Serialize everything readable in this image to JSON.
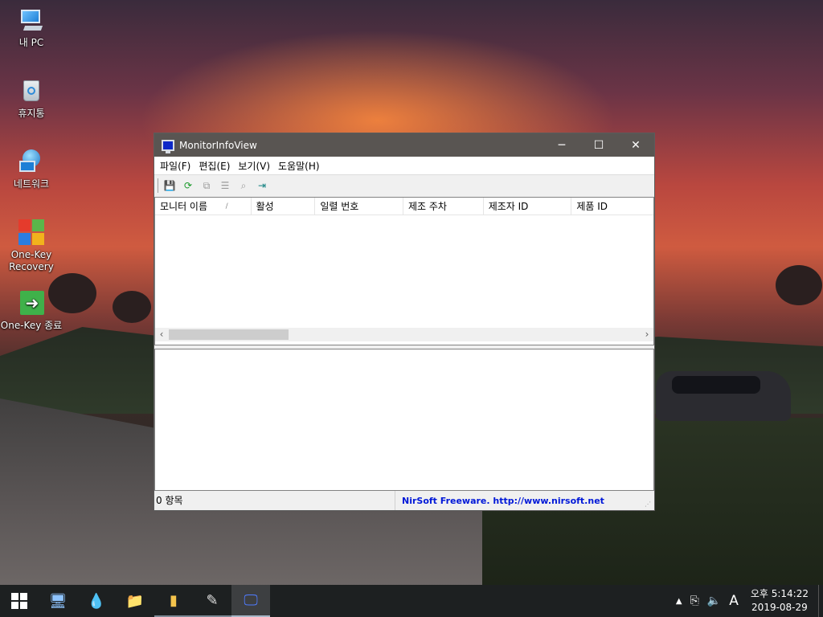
{
  "desktop": {
    "icons": [
      {
        "label": "내 PC",
        "icon": "computer-icon"
      },
      {
        "label": "휴지통",
        "icon": "recycle-bin-icon"
      },
      {
        "label": "네트워크",
        "icon": "network-icon"
      },
      {
        "label": "One-Key\nRecovery",
        "icon": "onekey-recovery-icon"
      },
      {
        "label": "One-Key 종료",
        "icon": "exit-icon"
      }
    ]
  },
  "window": {
    "title": "MonitorInfoView",
    "menu": [
      "파일(F)",
      "편집(E)",
      "보기(V)",
      "도움말(H)"
    ],
    "columns": [
      "모니터 이름",
      "활성",
      "일렬 번호",
      "제조 주차",
      "제조자 ID",
      "제품 ID"
    ],
    "sort_indicator": "/",
    "status": {
      "count": "0 항목",
      "credit": "NirSoft Freeware.  http://www.nirsoft.net"
    }
  },
  "taskbar": {
    "tray_ime": "A",
    "time": "오후 5:14:22",
    "date": "2019-08-29"
  }
}
